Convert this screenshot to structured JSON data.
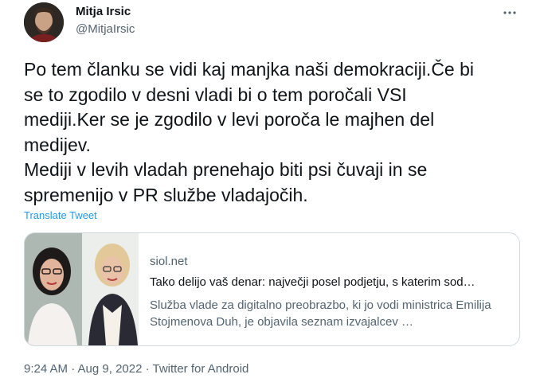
{
  "author": {
    "name": "Mitja Irsic",
    "handle": "@MitjaIrsic"
  },
  "tweet": {
    "text": "Po tem članku se vidi kaj manjka naši demokraciji.Če bi\nse to zgodilo v desni vladi bi o tem poročali VSI\nmediji.Ker se je zgodilo v levi poroča le majhen del\nmedijev.\nMediji v levih vladah prenehajo biti psi čuvaji in se\nspremenijo v PR službe vladajočih.",
    "translate_label": "Translate Tweet"
  },
  "link_card": {
    "domain": "siol.net",
    "title": "Tako delijo vaš denar: največji posel podjetju, s katerim sod…",
    "description": "Služba vlade za digitalno preobrazbo, ki jo vodi ministrica Emilija Stojmenova Duh, je objavila seznam izvajalcev …"
  },
  "meta": {
    "timestamp": "9:24 AM · Aug 9, 2022 · Twitter for Android"
  },
  "icons": {
    "more": "more-options-icon"
  },
  "colors": {
    "accent": "#1d9bf0",
    "text": "#0f1419",
    "secondary": "#536471",
    "border": "#cfd9de"
  }
}
